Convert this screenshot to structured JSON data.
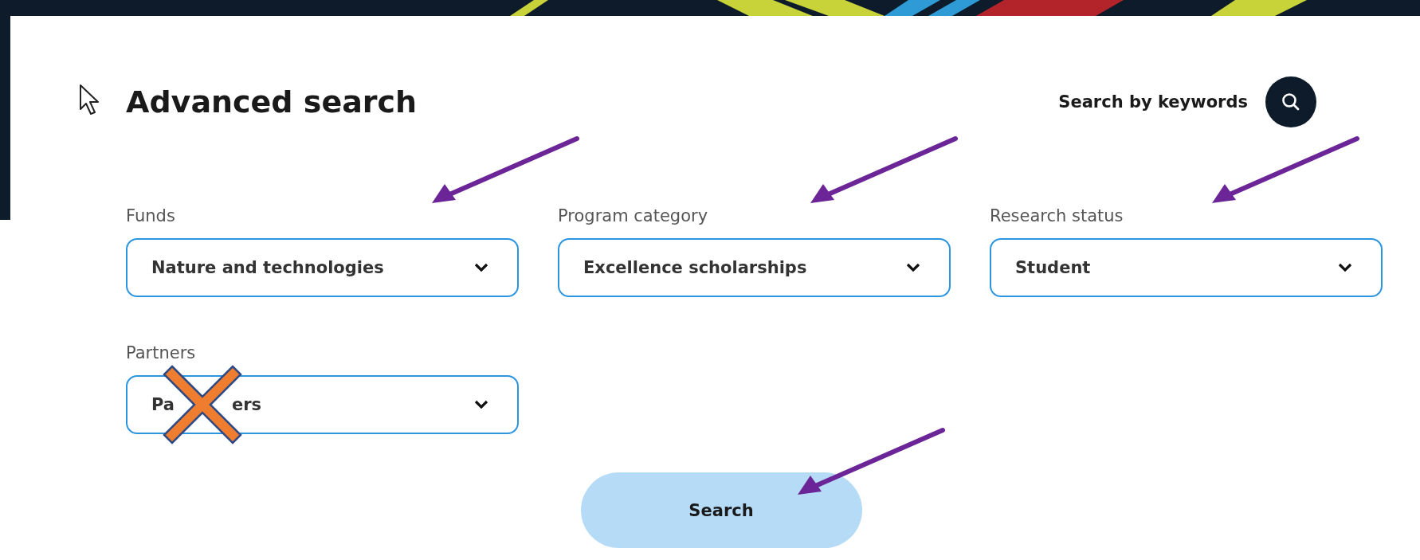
{
  "title": "Advanced search",
  "keyword_search": {
    "label": "Search by keywords"
  },
  "filters": [
    {
      "label": "Funds",
      "value": "Nature and technologies",
      "annotated": true,
      "crossed_out": false
    },
    {
      "label": "Program category",
      "value": "Excellence scholarships",
      "annotated": true,
      "crossed_out": false
    },
    {
      "label": "Research status",
      "value": "Student",
      "annotated": true,
      "crossed_out": false
    },
    {
      "label": "Partners",
      "value": [
        "Pa",
        "ers"
      ],
      "annotated": false,
      "crossed_out": true
    }
  ],
  "search_button": {
    "label": "Search",
    "annotated": true
  }
}
